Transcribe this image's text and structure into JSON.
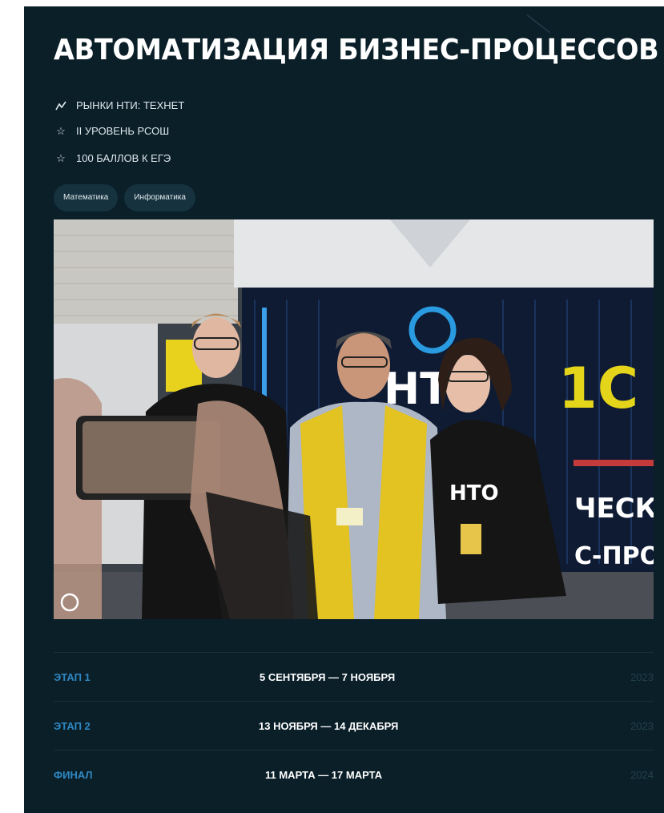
{
  "page": {
    "title": "АВТОМАТИЗАЦИЯ БИЗНЕС-ПРОЦЕССОВ",
    "meta": [
      {
        "icon": "trend-line-icon",
        "text": "РЫНКИ НТИ: ТЕХНЕТ"
      },
      {
        "icon": "star-icon",
        "text": "II УРОВЕНЬ РСОШ"
      },
      {
        "icon": "star-icon",
        "text": "100 БАЛЛОВ К ЕГЭ"
      }
    ],
    "tags": [
      "Математика",
      "Информатика"
    ]
  },
  "photo": {
    "banner_text_1": "НТО",
    "banner_text_2": "1С",
    "banner_text_3": "ЧЕСК",
    "banner_text_4": "С-ПРО",
    "shirt_text": "НТО"
  },
  "stages": [
    {
      "label": "ЭТАП 1",
      "dates": "5 СЕНТЯБРЯ — 7 НОЯБРЯ",
      "year": "2023"
    },
    {
      "label": "ЭТАП 2",
      "dates": "13 НОЯБРЯ — 14 ДЕКАБРЯ",
      "year": "2023"
    },
    {
      "label": "ФИНАЛ",
      "dates": "11 МАРТА — 17 МАРТА",
      "year": "2024"
    }
  ],
  "colors": {
    "card_bg": "#0b1f29",
    "accent": "#2f88c2",
    "tag_bg": "#16323f"
  }
}
